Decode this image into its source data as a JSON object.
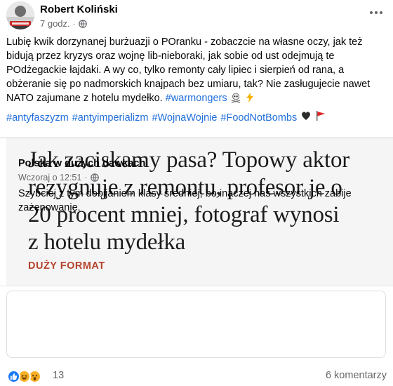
{
  "post": {
    "author": "Robert Koliński",
    "time": "7 godz.",
    "time_separator": "·",
    "text_lines": [
      "Lubię kwik dorzynanej burżuazji o POranku - zobaczcie na własne oczy, jak też",
      "bidują przez kryzys oraz wojnę lib-nieboraki, jak sobie od ust odejmują te",
      "POdżegackie łajdaki. A wy co, tylko remonty cały lipiec i sierpień od rana, a",
      "obżeranie się po nadmorskich knajpach bez umiaru, tak? Nie zasługujecie nawet",
      "NATO zajumane z hotelu mydełko."
    ],
    "inline_hashtag": "#warmongers",
    "hashtags": [
      "#antyfaszyzm",
      "#antyimperializm",
      "#WojnaWojnie",
      "#FoodNotBombs"
    ],
    "emojis": {
      "after_inline": [
        "skull-crossbones-icon",
        "lightning-icon"
      ],
      "after_hashtags": [
        "black-heart-icon",
        "red-flag-icon"
      ]
    }
  },
  "link_card": {
    "headline_lines": [
      "Jak zaciskamy pasa? Topowy aktor",
      "rezygnuje z remontu, profesor je o",
      "20 procent mniej, fotograf wynosi",
      "z hotelu mydełka"
    ],
    "section": "DUŻY FORMAT",
    "colors": {
      "section": "#b5432d",
      "image_bg": "#f5f5f5"
    }
  },
  "shared_post": {
    "name": "Polska w dużych dawkach",
    "time": "Wczoraj o 12:51",
    "time_separator": "·",
    "text_lines": [
      "Szybciej z tym dobijaniem klasy średniej, bo inaczej nas wszystkich zabije",
      "zażenowanie."
    ]
  },
  "footer": {
    "reaction_icons": [
      "like-icon",
      "haha-icon",
      "wow-icon"
    ],
    "reaction_count": "13",
    "comments": "6 komentarzy"
  },
  "colors": {
    "link": "#216fdb",
    "secondary_text": "#65676b",
    "like": "#1877f2",
    "haha": "#f7b125"
  }
}
